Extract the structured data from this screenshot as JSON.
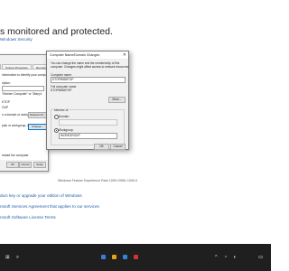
{
  "settings": {
    "headline": "s monitored and protected.",
    "top_link": "Windows Security",
    "links": [
      "duct key or upgrade your edition of Windows",
      "rosoft Services Agreement that applies to our services",
      "rosoft Software License Terms"
    ],
    "experience": "Windows Feature Experience Pack 1000.19061.1000.0"
  },
  "system_properties": {
    "tabs": [
      "",
      "System Protection",
      "Remote"
    ],
    "intro": "information to identify your computer",
    "lines": [
      "ription:",
      "\"Kitchen Computer\" or \"Mary's",
      "KTOP",
      "OUP"
    ],
    "join_line": "n a domain or workgroup, click",
    "rename_line": "pain or workgroup, click Change.",
    "network_id_button": "Network ID...",
    "change_button": "Change...",
    "restart_note": "restart the computer.",
    "ok_button": "OK",
    "cancel_button": "Cancel",
    "apply_button": "Apply"
  },
  "computer_name_dialog": {
    "title": "Computer Name/Domain Changes",
    "close_glyph": "✕",
    "description": [
      "You can change the name and the membership of this",
      "computer. Changes might affect access to network resources."
    ],
    "computer_name_label": "Computer name:",
    "computer_name_value": "DTOP8ND8TOP",
    "full_name_label": "Full computer name:",
    "full_name_value": "DTOP8ND8TOP",
    "more_button": "More...",
    "member_of_label": "Member of",
    "domain_label": "Domain:",
    "domain_value": "",
    "workgroup_label": "Workgroup:",
    "workgroup_value": "WORKGROUP",
    "selected_membership": "workgroup",
    "ok_button": "OK",
    "cancel_button": "Cancel"
  },
  "taskbar": {
    "start_glyph": "⊞",
    "search_glyph": "⌕",
    "app_colors": [
      "#3c7ddb",
      "#e3a21a",
      "#2b88d8",
      "#d13438"
    ],
    "tray_glyph": "^",
    "network_glyph": "◔",
    "volume_glyph": "◖",
    "notification_glyph": "▭",
    "colors": {
      "background": "#1f1f1f",
      "accent": "#0078d7"
    }
  }
}
